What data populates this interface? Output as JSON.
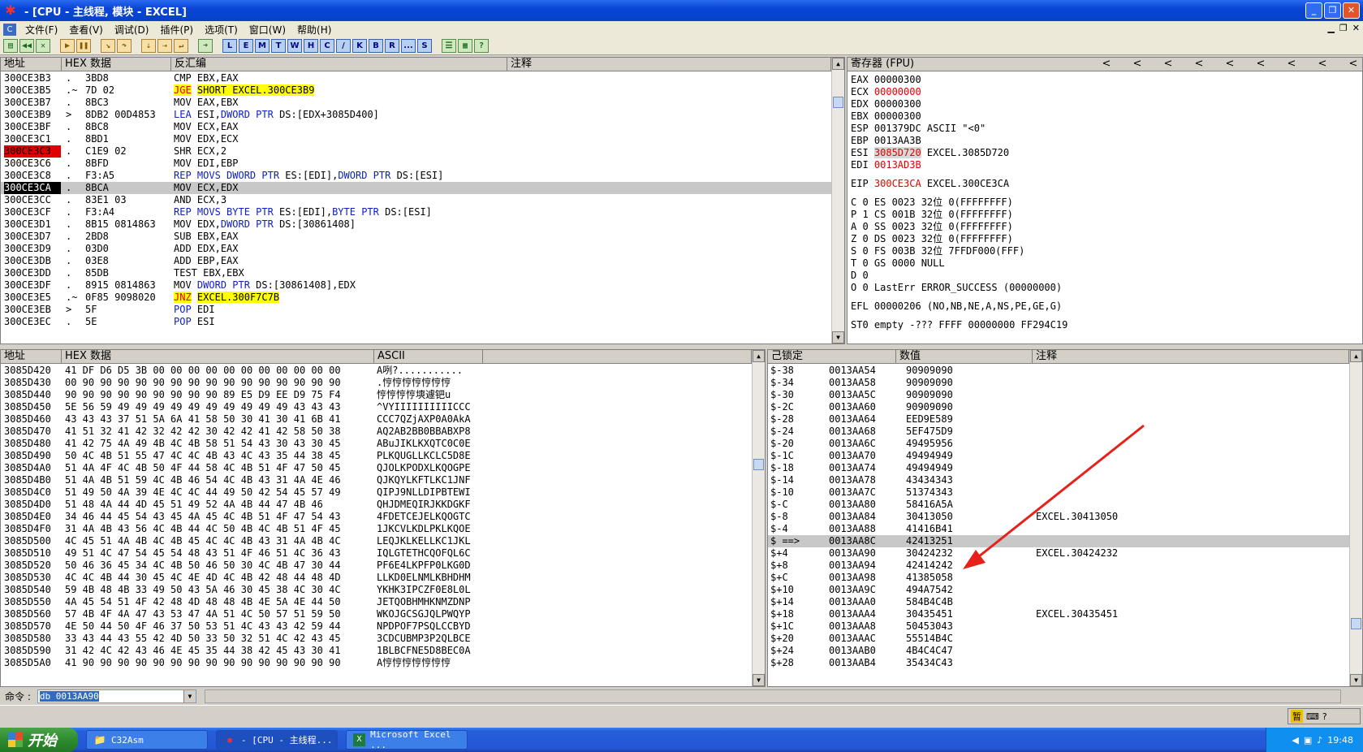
{
  "window": {
    "title": "- [CPU - 主线程, 模块 - EXCEL]",
    "icon": "ollydbg-bug-icon",
    "min": "_",
    "restore": "❐",
    "close": "✕"
  },
  "menu": [
    "文件(F)",
    "查看(V)",
    "调试(D)",
    "插件(P)",
    "选项(T)",
    "窗口(W)",
    "帮助(H)"
  ],
  "toolbar": {
    "letters": [
      "L",
      "E",
      "M",
      "T",
      "W",
      "H",
      "C",
      "/",
      "K",
      "B",
      "R",
      "...",
      "S"
    ]
  },
  "disasm": {
    "headers": [
      "地址",
      "HEX 数据",
      "反汇编",
      "注释"
    ],
    "rows": [
      {
        "addr": "300CE3B3",
        "m": ".",
        "hex": "3BD8",
        "mn": "CMP",
        "op": "EBX,EAX"
      },
      {
        "addr": "300CE3B5",
        "m": ".~",
        "hex": "7D 02",
        "mn": "JGE",
        "op": "SHORT EXCEL.300CE3B9",
        "jmp": true
      },
      {
        "addr": "300CE3B7",
        "m": ".",
        "hex": "8BC3",
        "mn": "MOV",
        "op": "EAX,EBX"
      },
      {
        "addr": "300CE3B9",
        "m": ">",
        "hex": "8DB2 00D4853",
        "mn": "LEA",
        "op": "ESI,DWORD PTR DS:[EDX+3085D400]"
      },
      {
        "addr": "300CE3BF",
        "m": ".",
        "hex": "8BC8",
        "mn": "MOV",
        "op": "ECX,EAX"
      },
      {
        "addr": "300CE3C1",
        "m": ".",
        "hex": "8BD1",
        "mn": "MOV",
        "op": "EDX,ECX"
      },
      {
        "addr": "300CE3C3",
        "m": ".",
        "hex": "C1E9 02",
        "mn": "SHR",
        "op": "ECX,2",
        "bp": true
      },
      {
        "addr": "300CE3C6",
        "m": ".",
        "hex": "8BFD",
        "mn": "MOV",
        "op": "EDI,EBP"
      },
      {
        "addr": "300CE3C8",
        "m": ".",
        "hex": "F3:A5",
        "mn": "REP MOVS",
        "op": "DWORD PTR ES:[EDI],DWORD PTR DS:[ESI]"
      },
      {
        "addr": "300CE3CA",
        "m": ".",
        "hex": "8BCA",
        "mn": "MOV",
        "op": "ECX,EDX",
        "cur": true
      },
      {
        "addr": "300CE3CC",
        "m": ".",
        "hex": "83E1 03",
        "mn": "AND",
        "op": "ECX,3"
      },
      {
        "addr": "300CE3CF",
        "m": ".",
        "hex": "F3:A4",
        "mn": "REP MOVS",
        "op": "BYTE PTR ES:[EDI],BYTE PTR DS:[ESI]"
      },
      {
        "addr": "300CE3D1",
        "m": ".",
        "hex": "8B15 0814863",
        "mn": "MOV",
        "op": "EDX,DWORD PTR DS:[30861408]"
      },
      {
        "addr": "300CE3D7",
        "m": ".",
        "hex": "2BD8",
        "mn": "SUB",
        "op": "EBX,EAX"
      },
      {
        "addr": "300CE3D9",
        "m": ".",
        "hex": "03D0",
        "mn": "ADD",
        "op": "EDX,EAX"
      },
      {
        "addr": "300CE3DB",
        "m": ".",
        "hex": "03E8",
        "mn": "ADD",
        "op": "EBP,EAX"
      },
      {
        "addr": "300CE3DD",
        "m": ".",
        "hex": "85DB",
        "mn": "TEST",
        "op": "EBX,EBX"
      },
      {
        "addr": "300CE3DF",
        "m": ".",
        "hex": "8915 0814863",
        "mn": "MOV",
        "op": "DWORD PTR DS:[30861408],EDX"
      },
      {
        "addr": "300CE3E5",
        "m": ".~",
        "hex": "0F85 9098020",
        "mn": "JNZ",
        "op": "EXCEL.300F7C7B",
        "jmp": true
      },
      {
        "addr": "300CE3EB",
        "m": ">",
        "hex": "5F",
        "mn": "POP",
        "op": "EDI"
      },
      {
        "addr": "300CE3EC",
        "m": ".",
        "hex": "5E",
        "mn": "POP",
        "op": "ESI"
      }
    ]
  },
  "registers": {
    "header": "寄存器 (FPU)",
    "arrows": "<",
    "lines": [
      {
        "t": [
          [
            "EAX ",
            ""
          ],
          [
            "00000300",
            ""
          ]
        ]
      },
      {
        "t": [
          [
            "ECX ",
            ""
          ],
          [
            "00000000",
            "red"
          ]
        ]
      },
      {
        "t": [
          [
            "EDX ",
            ""
          ],
          [
            "00000300",
            ""
          ]
        ]
      },
      {
        "t": [
          [
            "EBX ",
            ""
          ],
          [
            "00000300",
            ""
          ]
        ]
      },
      {
        "t": [
          [
            "ESP ",
            ""
          ],
          [
            "001379DC ASCII \"<0\"",
            ""
          ]
        ]
      },
      {
        "t": [
          [
            "EBP ",
            ""
          ],
          [
            "0013AA3B",
            ""
          ]
        ]
      },
      {
        "t": [
          [
            "ESI ",
            ""
          ],
          [
            "3085D720",
            "redbox"
          ],
          [
            " EXCEL.3085D720",
            ""
          ]
        ]
      },
      {
        "t": [
          [
            "EDI ",
            ""
          ],
          [
            "0013AD3B",
            "red"
          ]
        ]
      },
      {
        "gap": true
      },
      {
        "t": [
          [
            "EIP ",
            ""
          ],
          [
            "300CE3CA",
            "red"
          ],
          [
            " EXCEL.300CE3CA",
            ""
          ]
        ]
      },
      {
        "gap": true
      },
      {
        "t": [
          [
            "C 0  ES 0023 32位 0(FFFFFFFF)",
            ""
          ]
        ]
      },
      {
        "t": [
          [
            "P 1  CS 001B 32位 0(FFFFFFFF)",
            ""
          ]
        ]
      },
      {
        "t": [
          [
            "A 0  SS 0023 32位 0(FFFFFFFF)",
            ""
          ]
        ]
      },
      {
        "t": [
          [
            "Z 0  DS 0023 32位 0(FFFFFFFF)",
            ""
          ]
        ]
      },
      {
        "t": [
          [
            "S 0  FS 003B 32位 7FFDF000(FFF)",
            ""
          ]
        ]
      },
      {
        "t": [
          [
            "T 0  GS 0000 NULL",
            ""
          ]
        ]
      },
      {
        "t": [
          [
            "D 0",
            ""
          ]
        ]
      },
      {
        "t": [
          [
            "O 0  LastErr ERROR_SUCCESS (00000000)",
            ""
          ]
        ]
      },
      {
        "gap": true
      },
      {
        "t": [
          [
            "EFL 00000206 (NO,NB,NE,A,NS,PE,GE,G)",
            ""
          ]
        ]
      },
      {
        "gap": true
      },
      {
        "t": [
          [
            "ST0 empty -??? FFFF 00000000 FF294C19",
            ""
          ]
        ]
      }
    ]
  },
  "dump": {
    "headers": [
      "地址",
      "HEX 数据",
      "ASCII"
    ],
    "rows": [
      {
        "addr": "3085D420",
        "hex": "41 DF D6 D5 3B 00 00 00 00 00 00 00 00 00 00 00",
        "ascii": "A咧?..........."
      },
      {
        "addr": "3085D430",
        "hex": "00 90 90 90 90 90 90 90 90 90 90 90 90 90 90 90",
        "ascii": ".悙悙悙悙悙悙悙"
      },
      {
        "addr": "3085D440",
        "hex": "90 90 90 90 90 90 90 90 90 89 E5 D9 EE D9 75 F4",
        "ascii": "悙悙悙悙塽遽钯u"
      },
      {
        "addr": "3085D450",
        "hex": "5E 56 59 49 49 49 49 49 49 49 49 49 49 43 43 43",
        "ascii": "^VYIIIIIIIIIICCC"
      },
      {
        "addr": "3085D460",
        "hex": "43 43 43 37 51 5A 6A 41 58 50 30 41 30 41 6B 41",
        "ascii": "CCC7QZjAXP0A0AkA"
      },
      {
        "addr": "3085D470",
        "hex": "41 51 32 41 42 32 42 42 30 42 42 41 42 58 50 38",
        "ascii": "AQ2AB2BB0BBABXP8"
      },
      {
        "addr": "3085D480",
        "hex": "41 42 75 4A 49 4B 4C 4B 58 51 54 43 30 43 30 45",
        "ascii": "ABuJIKLKXQTC0C0E"
      },
      {
        "addr": "3085D490",
        "hex": "50 4C 4B 51 55 47 4C 4C 4B 43 4C 43 35 44 38 45",
        "ascii": "PLKQUGLLKCLC5D8E"
      },
      {
        "addr": "3085D4A0",
        "hex": "51 4A 4F 4C 4B 50 4F 44 58 4C 4B 51 4F 47 50 45",
        "ascii": "QJOLKPODXLKQOGPE"
      },
      {
        "addr": "3085D4B0",
        "hex": "51 4A 4B 51 59 4C 4B 46 54 4C 4B 43 31 4A 4E 46",
        "ascii": "QJKQYLKFTLKC1JNF"
      },
      {
        "addr": "3085D4C0",
        "hex": "51 49 50 4A 39 4E 4C 4C 44 49 50 42 54 45 57 49",
        "ascii": "QIPJ9NLLDIPBTEWI"
      },
      {
        "addr": "3085D4D0",
        "hex": "51 48 4A 44 4D 45 51 49 52 4A 4B 44 47 4B 46",
        "ascii": "QHJDMEQIRJKKDGKF"
      },
      {
        "addr": "3085D4E0",
        "hex": "34 46 44 45 54 43 45 4A 45 4C 4B 51 4F 47 54 43",
        "ascii": "4FDETCEJELKQOGTC"
      },
      {
        "addr": "3085D4F0",
        "hex": "31 4A 4B 43 56 4C 4B 44 4C 50 4B 4C 4B 51 4F 45",
        "ascii": "1JKCVLKDLPKLKQOE"
      },
      {
        "addr": "3085D500",
        "hex": "4C 45 51 4A 4B 4C 4B 45 4C 4C 4B 43 31 4A 4B 4C",
        "ascii": "LEQJKLKELLKC1JKL"
      },
      {
        "addr": "3085D510",
        "hex": "49 51 4C 47 54 45 54 48 43 51 4F 46 51 4C 36 43",
        "ascii": "IQLGTETHCQOFQL6C"
      },
      {
        "addr": "3085D520",
        "hex": "50 46 36 45 34 4C 4B 50 46 50 30 4C 4B 47 30 44",
        "ascii": "PF6E4LKPFP0LKG0D"
      },
      {
        "addr": "3085D530",
        "hex": "4C 4C 4B 44 30 45 4C 4E 4D 4C 4B 42 48 44 48 4D",
        "ascii": "LLKD0ELNMLKBHDHM"
      },
      {
        "addr": "3085D540",
        "hex": "59 4B 48 4B 33 49 50 43 5A 46 30 45 38 4C 30 4C",
        "ascii": "YKHK3IPCZF0E8L0L"
      },
      {
        "addr": "3085D550",
        "hex": "4A 45 54 51 4F 42 48 4D 48 48 4B 4E 5A 4E 44 50",
        "ascii": "JETQOBHMHKNMZDNP"
      },
      {
        "addr": "3085D560",
        "hex": "57 4B 4F 4A 47 43 53 47 4A 51 4C 50 57 51 59 50",
        "ascii": "WKOJGCSGJQLPWQYP"
      },
      {
        "addr": "3085D570",
        "hex": "4E 50 44 50 4F 46 37 50 53 51 4C 43 43 42 59 44",
        "ascii": "NPDPOF7PSQLCCBYD"
      },
      {
        "addr": "3085D580",
        "hex": "33 43 44 43 55 42 4D 50 33 50 32 51 4C 42 43 45",
        "ascii": "3CDCUBMP3P2QLBCE"
      },
      {
        "addr": "3085D590",
        "hex": "31 42 4C 42 43 46 4E 45 35 44 38 42 45 43 30 41",
        "ascii": "1BLBCFNE5D8BEC0A"
      },
      {
        "addr": "3085D5A0",
        "hex": "41 90 90 90 90 90 90 90 90 90 90 90 90 90 90 90",
        "ascii": "A悙悙悙悙悙悙悙"
      }
    ]
  },
  "stack": {
    "headers": [
      "己锁定",
      "数值",
      "注释"
    ],
    "rows": [
      {
        "off": "$-38",
        "addr": "0013AA54",
        "val": "90909090",
        "cmt": ""
      },
      {
        "off": "$-34",
        "addr": "0013AA58",
        "val": "90909090",
        "cmt": ""
      },
      {
        "off": "$-30",
        "addr": "0013AA5C",
        "val": "90909090",
        "cmt": ""
      },
      {
        "off": "$-2C",
        "addr": "0013AA60",
        "val": "90909090",
        "cmt": ""
      },
      {
        "off": "$-28",
        "addr": "0013AA64",
        "val": "EED9E589",
        "cmt": ""
      },
      {
        "off": "$-24",
        "addr": "0013AA68",
        "val": "5EF475D9",
        "cmt": ""
      },
      {
        "off": "$-20",
        "addr": "0013AA6C",
        "val": "49495956",
        "cmt": ""
      },
      {
        "off": "$-1C",
        "addr": "0013AA70",
        "val": "49494949",
        "cmt": ""
      },
      {
        "off": "$-18",
        "addr": "0013AA74",
        "val": "49494949",
        "cmt": ""
      },
      {
        "off": "$-14",
        "addr": "0013AA78",
        "val": "43434343",
        "cmt": ""
      },
      {
        "off": "$-10",
        "addr": "0013AA7C",
        "val": "51374343",
        "cmt": ""
      },
      {
        "off": "$-C",
        "addr": "0013AA80",
        "val": "58416A5A",
        "cmt": ""
      },
      {
        "off": "$-8",
        "addr": "0013AA84",
        "val": "30413050",
        "cmt": "EXCEL.30413050"
      },
      {
        "off": "$-4",
        "addr": "0013AA88",
        "val": "41416B41",
        "cmt": ""
      },
      {
        "off": "$ ==>",
        "addr": "0013AA8C",
        "val": "42413251",
        "cmt": "",
        "cur": true
      },
      {
        "off": "$+4",
        "addr": "0013AA90",
        "val": "30424232",
        "cmt": "EXCEL.30424232"
      },
      {
        "off": "$+8",
        "addr": "0013AA94",
        "val": "42414242",
        "cmt": ""
      },
      {
        "off": "$+C",
        "addr": "0013AA98",
        "val": "41385058",
        "cmt": ""
      },
      {
        "off": "$+10",
        "addr": "0013AA9C",
        "val": "494A7542",
        "cmt": ""
      },
      {
        "off": "$+14",
        "addr": "0013AAA0",
        "val": "584B4C4B",
        "cmt": ""
      },
      {
        "off": "$+18",
        "addr": "0013AAA4",
        "val": "30435451",
        "cmt": "EXCEL.30435451"
      },
      {
        "off": "$+1C",
        "addr": "0013AAA8",
        "val": "50453043",
        "cmt": ""
      },
      {
        "off": "$+20",
        "addr": "0013AAAC",
        "val": "55514B4C",
        "cmt": ""
      },
      {
        "off": "$+24",
        "addr": "0013AAB0",
        "val": "4B4C4C47",
        "cmt": ""
      },
      {
        "off": "$+28",
        "addr": "0013AAB4",
        "val": "35434C43",
        "cmt": ""
      }
    ]
  },
  "command": {
    "label": "命令 :",
    "value": "db 0013AA90"
  },
  "taskbar": {
    "start": "开始",
    "tasks": [
      "C32Asm",
      "- [CPU - 主线程...",
      "Microsoft Excel ..."
    ],
    "clock": "19:48",
    "ime": "暂"
  },
  "colors": {
    "arrow": "#e8201a",
    "current_row": "#c8c8c8",
    "breakpoint": "#e00000"
  }
}
